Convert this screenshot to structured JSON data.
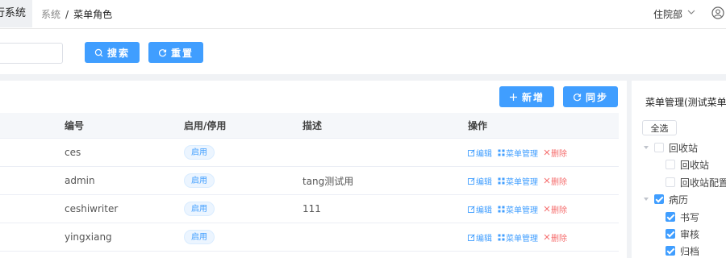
{
  "header": {
    "system_title": "行系统",
    "breadcrumb": {
      "parent": "系统",
      "separator": "/",
      "current": "菜单角色"
    },
    "department": "住院部"
  },
  "search": {
    "search_button": "搜索",
    "reset_button": "重置"
  },
  "toolbar": {
    "add_button": "新增",
    "sync_button": "同步"
  },
  "table": {
    "columns": {
      "code": "编号",
      "status": "启用/停用",
      "desc": "描述",
      "ops": "操作"
    },
    "rows": [
      {
        "code": "ces",
        "status": "启用",
        "desc": ""
      },
      {
        "code": "admin",
        "status": "启用",
        "desc": "tang测试用"
      },
      {
        "code": "ceshiwriter",
        "status": "启用",
        "desc": "111"
      },
      {
        "code": "yingxiang",
        "status": "启用",
        "desc": ""
      }
    ],
    "ops": {
      "edit": "编辑",
      "menu": "菜单管理",
      "delete": "删除"
    }
  },
  "menu_panel": {
    "title": "菜单管理(测试菜单权",
    "select_all": "全选",
    "tree": [
      {
        "label": "回收站",
        "checked": false
      },
      {
        "label": "回收站",
        "checked": false
      },
      {
        "label": "回收站配置",
        "checked": false
      },
      {
        "label": "病历",
        "checked": true
      },
      {
        "label": "书写",
        "checked": true
      },
      {
        "label": "审核",
        "checked": true
      },
      {
        "label": "归档",
        "checked": true
      }
    ]
  },
  "colors": {
    "primary": "#409eff",
    "danger": "#f56c6c"
  }
}
